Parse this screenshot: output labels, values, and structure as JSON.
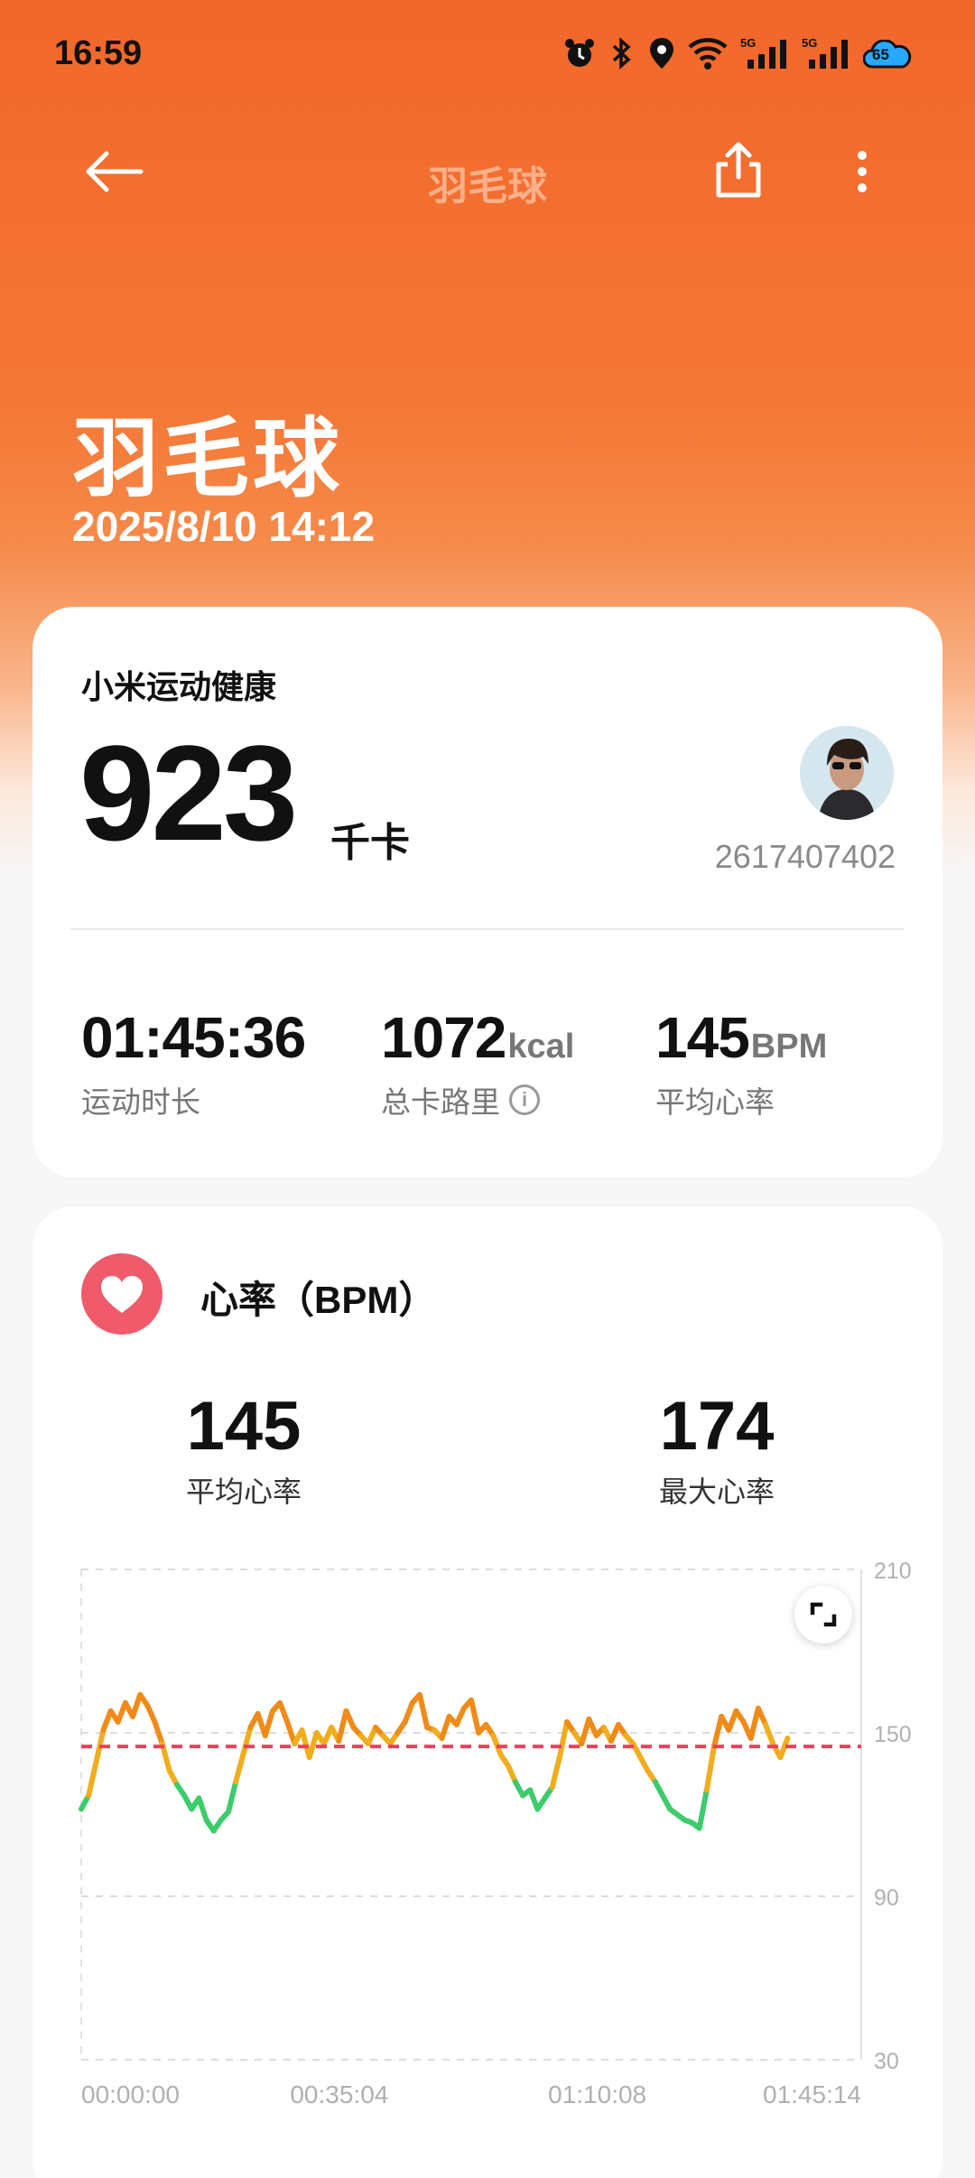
{
  "status_bar": {
    "time": "16:59",
    "battery": "65"
  },
  "top_bar": {
    "title": "羽毛球"
  },
  "header": {
    "title": "羽毛球",
    "datetime": "2025/8/10 14:12"
  },
  "summary": {
    "brand": "小米运动健康",
    "calories": "923",
    "calories_unit": "千卡",
    "user_id": "2617407402",
    "stats": [
      {
        "value": "01:45:36",
        "unit": "",
        "label": "运动时长"
      },
      {
        "value": "1072",
        "unit": "kcal",
        "label": "总卡路里"
      },
      {
        "value": "145",
        "unit": "BPM",
        "label": "平均心率"
      }
    ]
  },
  "heart_rate": {
    "title": "心率（BPM）",
    "avg_value": "145",
    "avg_label": "平均心率",
    "max_value": "174",
    "max_label": "最大心率"
  },
  "chart_data": {
    "type": "line",
    "title": "",
    "y_ticks": [
      "210",
      "150",
      "90",
      "30"
    ],
    "ylim": [
      30,
      210
    ],
    "x_ticks": [
      "00:00:00",
      "00:35:04",
      "01:10:08",
      "01:45:14"
    ],
    "xlim": [
      0,
      106
    ],
    "average_line": 145,
    "colors": {
      "low": "#3dcb6c",
      "mid": "#f0ad1d",
      "high": "#ef8b19",
      "peak": "#f4557a",
      "avg": "#e8425a"
    },
    "series": [
      {
        "x_unit": "min",
        "values": [
          [
            0,
            122
          ],
          [
            1,
            127
          ],
          [
            2,
            139
          ],
          [
            3,
            151
          ],
          [
            4,
            158
          ],
          [
            5,
            154
          ],
          [
            6,
            161
          ],
          [
            7,
            156
          ],
          [
            8,
            164
          ],
          [
            9,
            160
          ],
          [
            10,
            154
          ],
          [
            11,
            146
          ],
          [
            12,
            136
          ],
          [
            13,
            131
          ],
          [
            14,
            127
          ],
          [
            15,
            122
          ],
          [
            16,
            126
          ],
          [
            17,
            118
          ],
          [
            18,
            114
          ],
          [
            19,
            118
          ],
          [
            20,
            121
          ],
          [
            21,
            132
          ],
          [
            22,
            142
          ],
          [
            23,
            152
          ],
          [
            24,
            157
          ],
          [
            25,
            149
          ],
          [
            26,
            158
          ],
          [
            27,
            161
          ],
          [
            28,
            154
          ],
          [
            29,
            146
          ],
          [
            30,
            151
          ],
          [
            31,
            141
          ],
          [
            32,
            150
          ],
          [
            33,
            146
          ],
          [
            34,
            152
          ],
          [
            35,
            147
          ],
          [
            36,
            158
          ],
          [
            37,
            152
          ],
          [
            38,
            149
          ],
          [
            39,
            146
          ],
          [
            40,
            152
          ],
          [
            41,
            149
          ],
          [
            42,
            146
          ],
          [
            43,
            150
          ],
          [
            44,
            154
          ],
          [
            45,
            161
          ],
          [
            46,
            164
          ],
          [
            47,
            152
          ],
          [
            48,
            151
          ],
          [
            49,
            148
          ],
          [
            50,
            156
          ],
          [
            51,
            153
          ],
          [
            52,
            159
          ],
          [
            53,
            162
          ],
          [
            54,
            150
          ],
          [
            55,
            153
          ],
          [
            56,
            149
          ],
          [
            57,
            142
          ],
          [
            58,
            138
          ],
          [
            59,
            132
          ],
          [
            60,
            127
          ],
          [
            61,
            129
          ],
          [
            62,
            122
          ],
          [
            63,
            126
          ],
          [
            64,
            130
          ],
          [
            65,
            141
          ],
          [
            66,
            154
          ],
          [
            67,
            150
          ],
          [
            68,
            146
          ],
          [
            69,
            155
          ],
          [
            70,
            149
          ],
          [
            71,
            152
          ],
          [
            72,
            147
          ],
          [
            73,
            153
          ],
          [
            74,
            149
          ],
          [
            75,
            146
          ],
          [
            76,
            141
          ],
          [
            77,
            136
          ],
          [
            78,
            132
          ],
          [
            79,
            127
          ],
          [
            80,
            122
          ],
          [
            81,
            120
          ],
          [
            82,
            118
          ],
          [
            83,
            117
          ],
          [
            84,
            115
          ],
          [
            85,
            129
          ],
          [
            86,
            145
          ],
          [
            87,
            156
          ],
          [
            88,
            151
          ],
          [
            89,
            158
          ],
          [
            90,
            154
          ],
          [
            91,
            148
          ],
          [
            92,
            159
          ],
          [
            93,
            153
          ],
          [
            94,
            146
          ],
          [
            95,
            141
          ],
          [
            96,
            148
          ]
        ]
      }
    ]
  }
}
